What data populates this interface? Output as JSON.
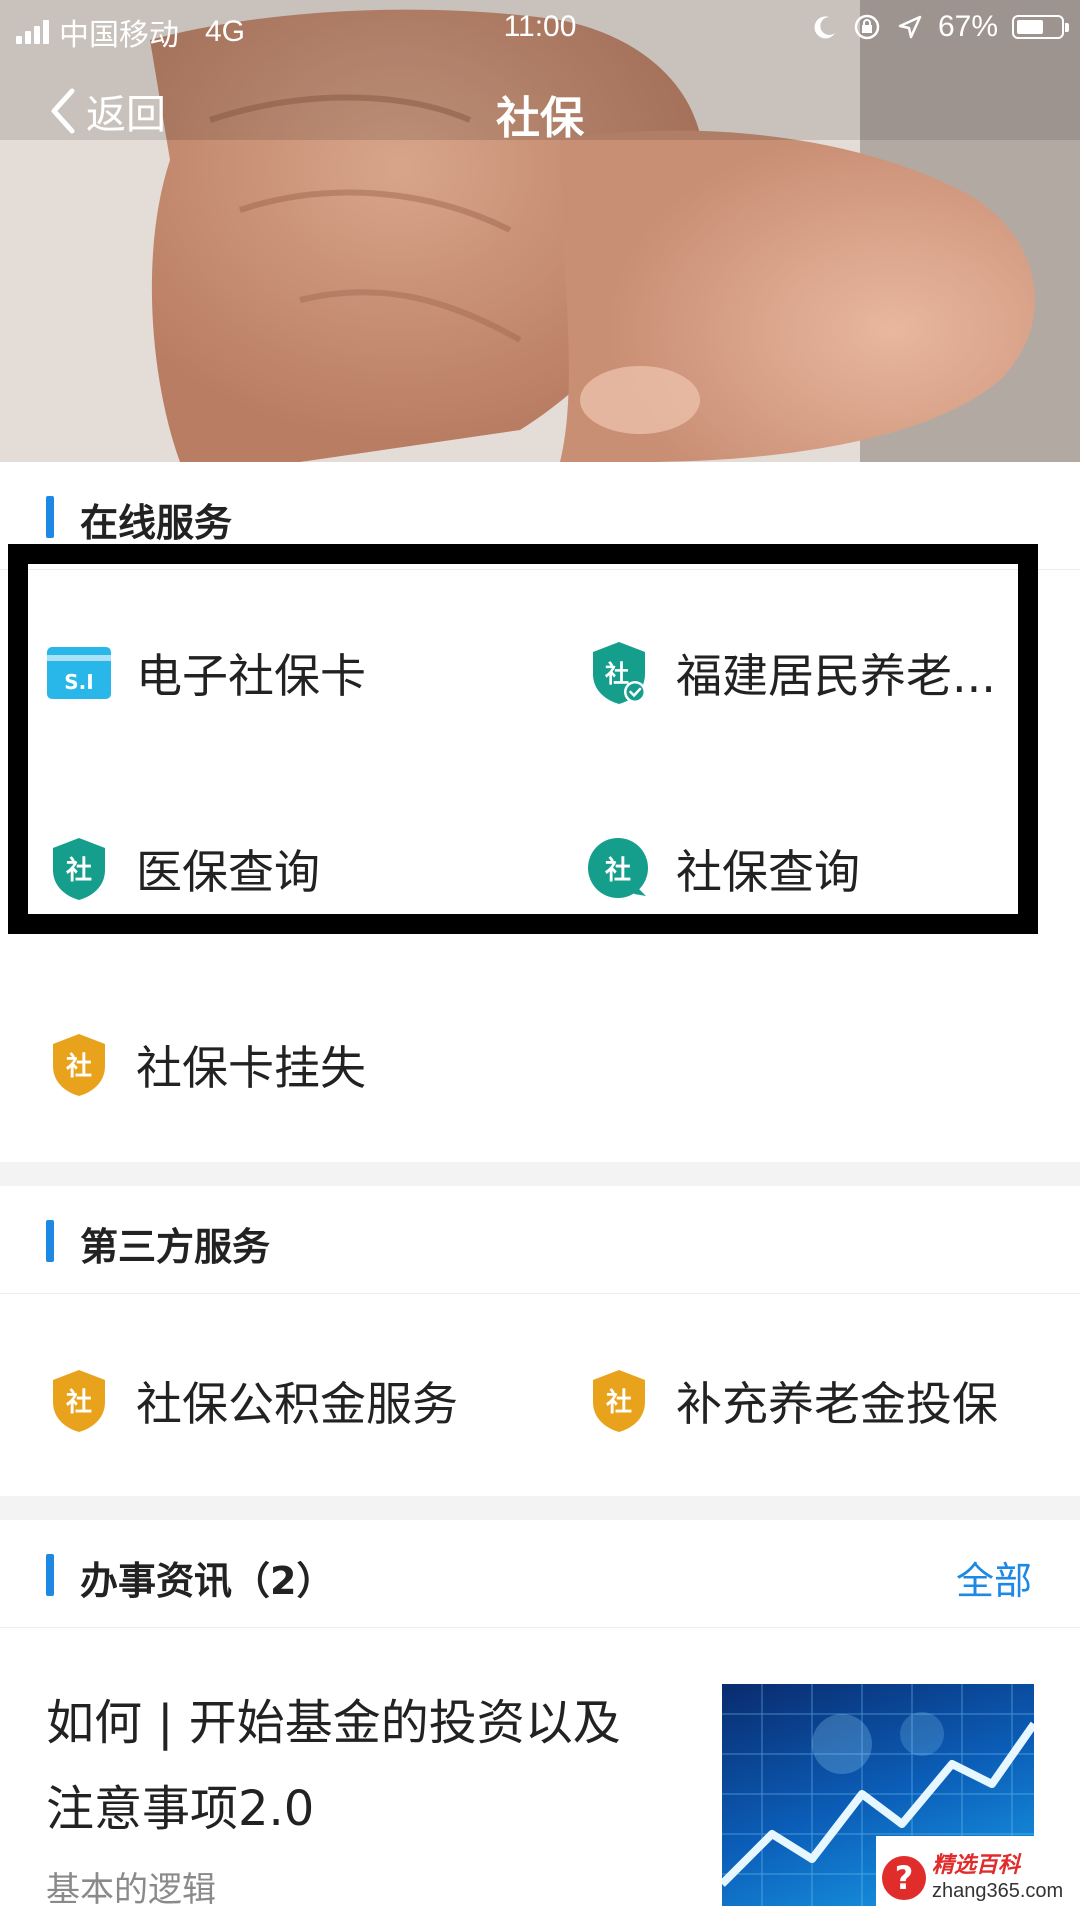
{
  "status_bar": {
    "carrier": "中国移动",
    "network": "4G",
    "time": "11:00",
    "battery": "67%",
    "battery_level": 0.67,
    "icons": [
      "signal-icon",
      "moon-icon",
      "rotation-lock-icon",
      "location-icon",
      "battery-icon"
    ]
  },
  "nav": {
    "back_label": "返回",
    "title": "社保"
  },
  "online_services": {
    "title": "在线服务",
    "items": [
      {
        "label": "电子社保卡",
        "icon": "si-card-icon",
        "icon_text": "S.I",
        "color": "#29b6e8"
      },
      {
        "label": "福建居民养老...",
        "icon": "shield-check-icon",
        "icon_text": "社",
        "color": "#159e8c"
      },
      {
        "label": "医保查询",
        "icon": "shield-icon",
        "icon_text": "社",
        "color": "#159e8c"
      },
      {
        "label": "社保查询",
        "icon": "search-badge-icon",
        "icon_text": "社",
        "color": "#159e8c"
      },
      {
        "label": "社保卡挂失",
        "icon": "shield-icon",
        "icon_text": "社",
        "color": "#e9a21b"
      }
    ]
  },
  "third_party": {
    "title": "第三方服务",
    "items": [
      {
        "label": "社保公积金服务",
        "icon": "shield-icon",
        "icon_text": "社",
        "color": "#e9a21b"
      },
      {
        "label": "补充养老金投保",
        "icon": "shield-icon",
        "icon_text": "社",
        "color": "#e9a21b"
      }
    ]
  },
  "news": {
    "title": "办事资讯（2）",
    "more_label": "全部",
    "articles": [
      {
        "title": "如何 | 开始基金的投资以及注意事项2.0",
        "subtitle": "基本的逻辑"
      }
    ]
  },
  "watermark": {
    "brand": "精选百科",
    "url": "zhang365.com",
    "symbol": "?"
  },
  "colors": {
    "accent": "#1e88e5",
    "teal": "#159e8c",
    "orange": "#e9a21b",
    "card_blue": "#29b6e8"
  }
}
